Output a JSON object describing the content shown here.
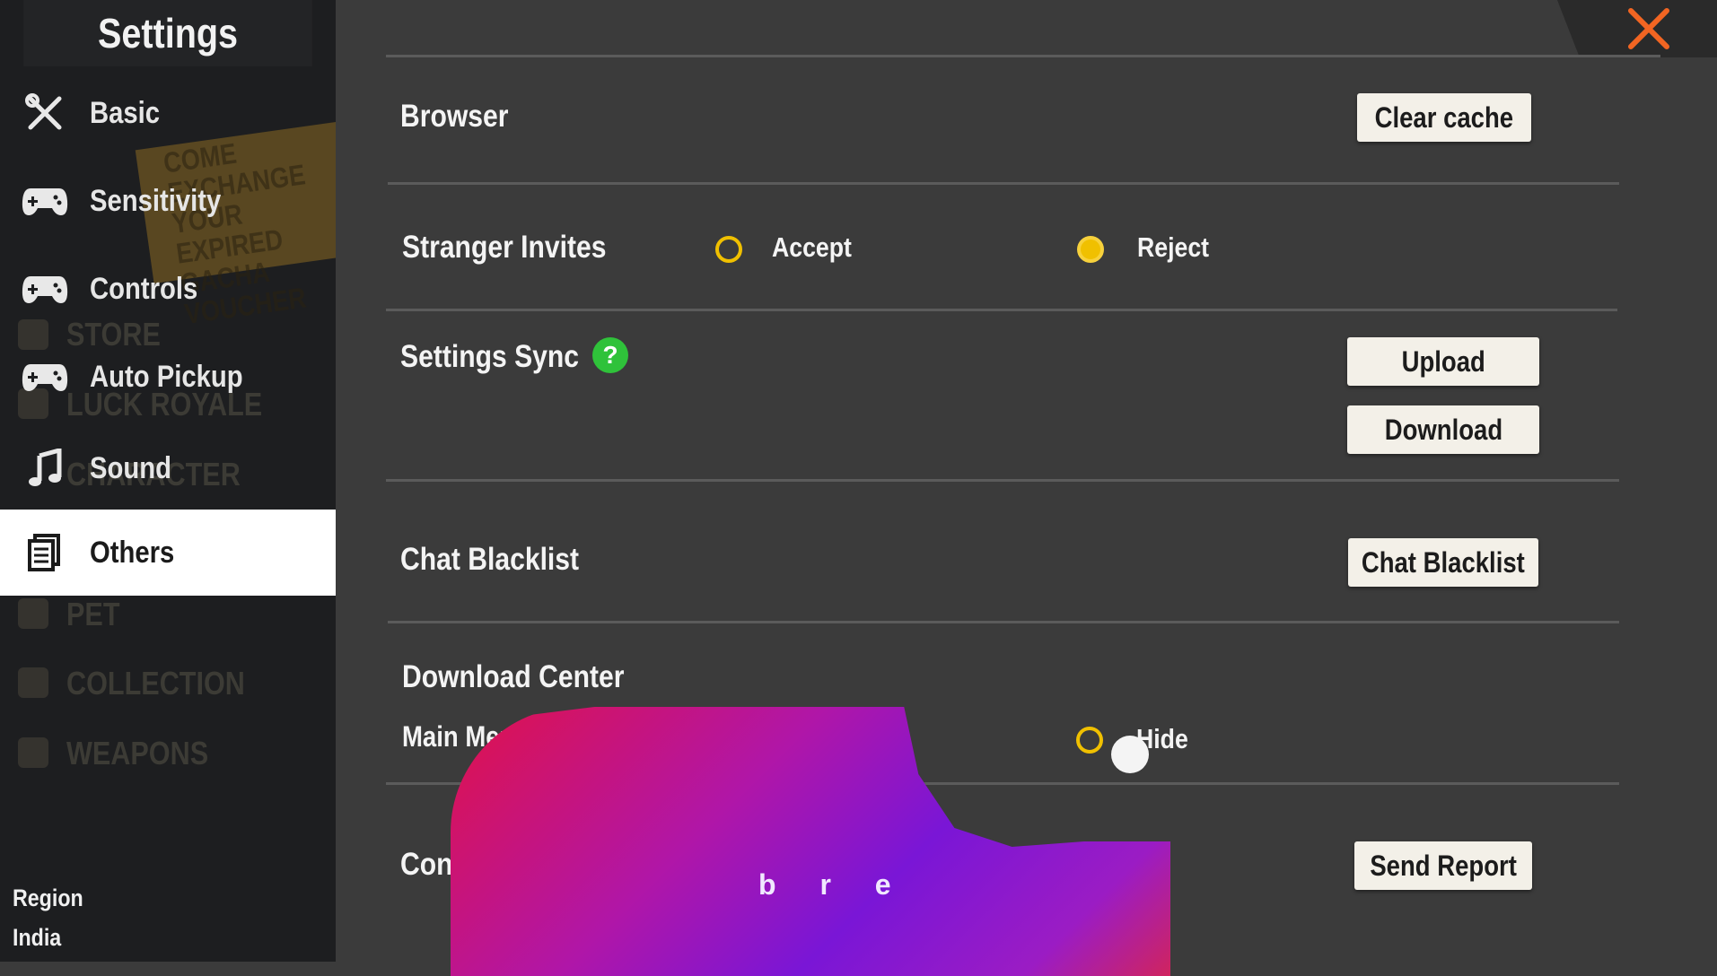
{
  "sidebar": {
    "title": "Settings",
    "banner_text": "COME EXCHANGE YOUR EXPIRED GACHA VOUCHER",
    "ghost_items": [
      "STORE",
      "LUCK ROYALE",
      "CHARACTER",
      "PET",
      "COLLECTION",
      "WEAPONS"
    ],
    "items": [
      {
        "label": "Basic",
        "icon": "tools-icon"
      },
      {
        "label": "Sensitivity",
        "icon": "gamepad-icon"
      },
      {
        "label": "Controls",
        "icon": "gamepad-icon"
      },
      {
        "label": "Auto Pickup",
        "icon": "gamepad-icon"
      },
      {
        "label": "Sound",
        "icon": "music-note-icon"
      },
      {
        "label": "Others",
        "icon": "document-icon",
        "active": true
      }
    ],
    "region_label": "Region",
    "region_value": "India"
  },
  "main": {
    "close_icon": "close-icon",
    "browser": {
      "label": "Browser",
      "button": "Clear cache"
    },
    "stranger_invites": {
      "label": "Stranger Invites",
      "options": [
        "Accept",
        "Reject"
      ],
      "selected": "Reject"
    },
    "settings_sync": {
      "label": "Settings Sync",
      "help": "?",
      "upload": "Upload",
      "download": "Download"
    },
    "chat_blacklist": {
      "label": "Chat Blacklist",
      "button": "Chat Blacklist"
    },
    "download_center": {
      "label": "Download Center",
      "sub_label": "Main Menu E",
      "option": "Hide"
    },
    "connection": {
      "label": "Conn",
      "button": "Send Report"
    }
  },
  "overlay": {
    "text": "b r e"
  },
  "colors": {
    "accent": "#f0c000",
    "close": "#f26522",
    "help": "#2fc23a",
    "active_bg": "#ffffff"
  }
}
